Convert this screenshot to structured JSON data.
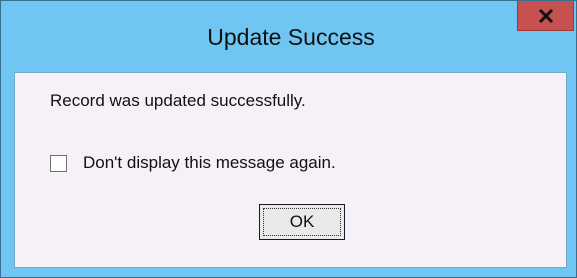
{
  "window": {
    "title": "Update Success",
    "close_icon": "close-icon"
  },
  "dialog": {
    "message": "Record was updated successfully.",
    "checkbox_label": "Don't display this message again.",
    "checkbox_checked": false,
    "ok_label": "OK"
  },
  "colors": {
    "frame": "#6fc6f3",
    "client": "#f6f1f8",
    "close_button": "#c75050"
  }
}
